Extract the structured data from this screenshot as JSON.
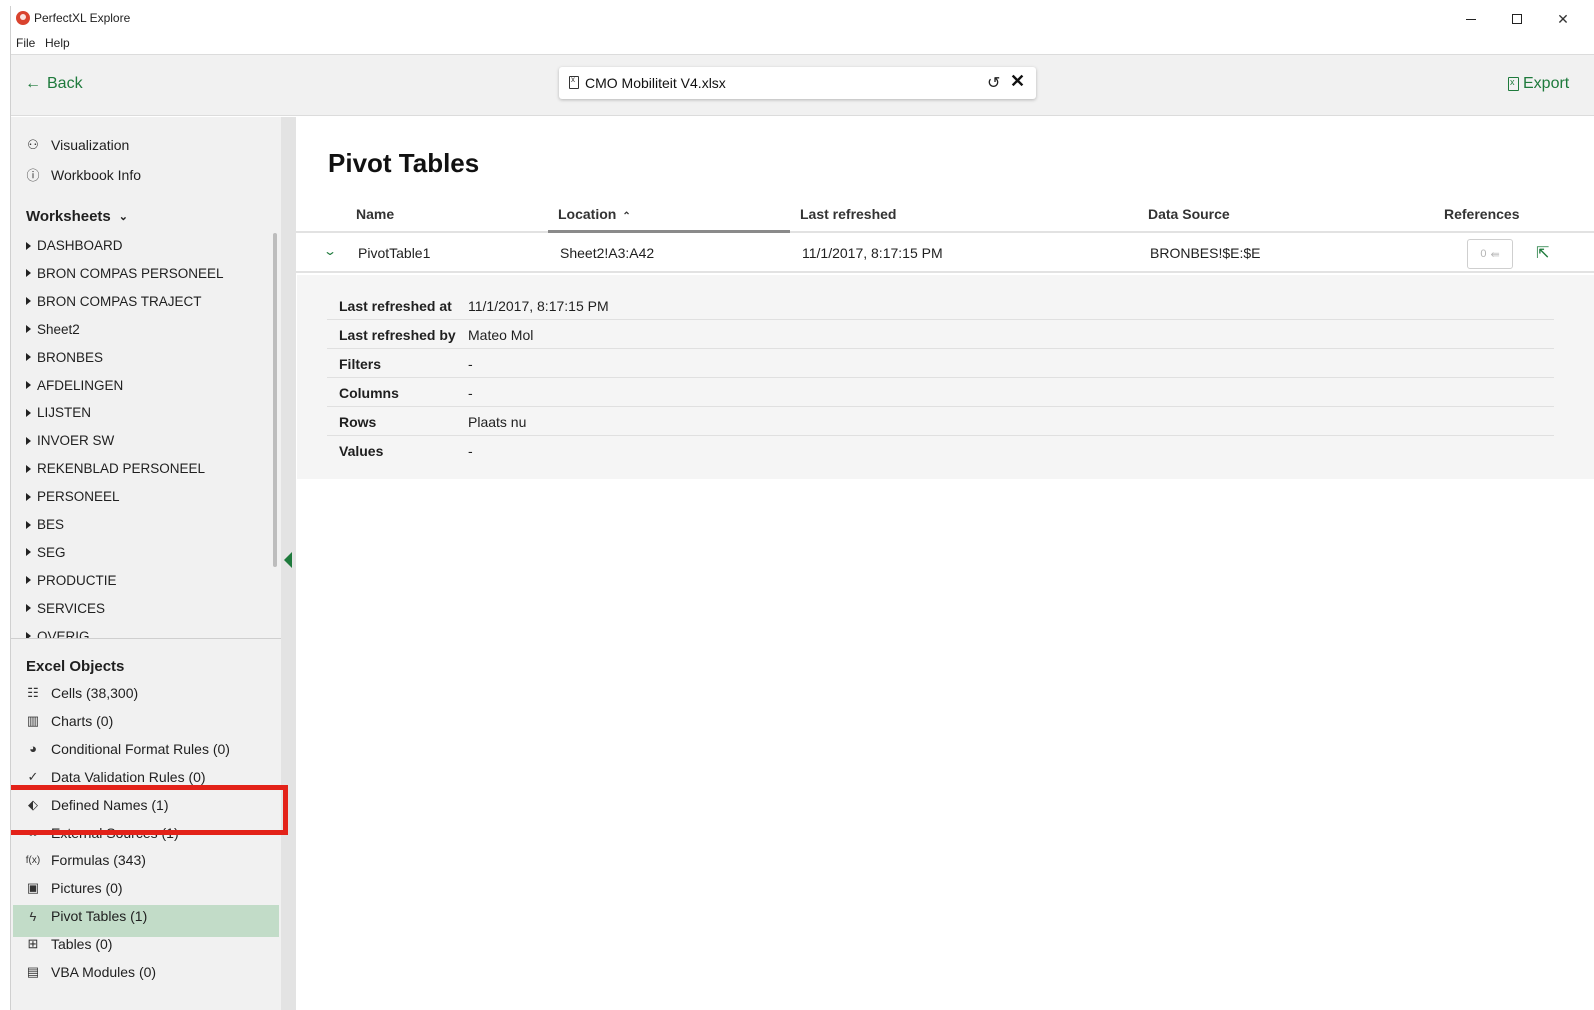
{
  "window": {
    "app_title": "PerfectXL Explore",
    "menu": [
      "File",
      "Help"
    ],
    "controls": {
      "minimize": "—",
      "maximize": "☐",
      "close": "✕"
    }
  },
  "toolbar": {
    "back_label": "Back",
    "file_name": "CMO Mobiliteit V4.xlsx",
    "export_label": "Export"
  },
  "sidebar": {
    "top_items": [
      {
        "label": "Visualization",
        "icon": "visualization-icon"
      },
      {
        "label": "Workbook Info",
        "icon": "info-icon"
      }
    ],
    "worksheets_title": "Worksheets",
    "worksheets": [
      "DASHBOARD",
      "BRON COMPAS PERSONEEL",
      "BRON COMPAS TRAJECT",
      "Sheet2",
      "BRONBES",
      "AFDELINGEN",
      "LIJSTEN",
      "INVOER SW",
      "REKENBLAD PERSONEEL",
      "PERSONEEL",
      "BES",
      "SEG",
      "PRODUCTIE",
      "SERVICES",
      "OVERIG"
    ],
    "excel_objects_title": "Excel Objects",
    "excel_objects": [
      {
        "label": "Cells (38,300)",
        "icon": "cells-icon"
      },
      {
        "label": "Charts (0)",
        "icon": "chart-icon"
      },
      {
        "label": "Conditional Format Rules (0)",
        "icon": "palette-icon"
      },
      {
        "label": "Data Validation Rules (0)",
        "icon": "check-circle-icon"
      },
      {
        "label": "Defined Names (1)",
        "icon": "tag-icon"
      },
      {
        "label": "External Sources (1)",
        "icon": "link-icon"
      },
      {
        "label": "Formulas (343)",
        "icon": "function-icon"
      },
      {
        "label": "Pictures (0)",
        "icon": "picture-icon"
      },
      {
        "label": "Pivot Tables (1)",
        "icon": "bolt-icon"
      },
      {
        "label": "Tables (0)",
        "icon": "table-icon"
      },
      {
        "label": "VBA Modules (0)",
        "icon": "script-icon"
      }
    ],
    "active_item": "Pivot Tables (1)"
  },
  "main": {
    "title": "Pivot Tables",
    "columns": [
      "Name",
      "Location",
      "Last refreshed",
      "Data Source",
      "References"
    ],
    "row": {
      "name": "PivotTable1",
      "location": "Sheet2!A3:A42",
      "last_refreshed": "11/1/2017, 8:17:15 PM",
      "data_source": "BRONBES!$E:$E",
      "references": "0"
    },
    "details": [
      {
        "label": "Last refreshed at",
        "value": "11/1/2017, 8:17:15 PM"
      },
      {
        "label": "Last refreshed by",
        "value": "Mateo Mol"
      },
      {
        "label": "Filters",
        "value": "-"
      },
      {
        "label": "Columns",
        "value": "-"
      },
      {
        "label": "Rows",
        "value": "Plaats nu"
      },
      {
        "label": "Values",
        "value": "-"
      }
    ]
  },
  "colors": {
    "accent": "#1e7a3c",
    "active_bg": "#c2dcc8",
    "highlight_outline": "#e32219"
  }
}
